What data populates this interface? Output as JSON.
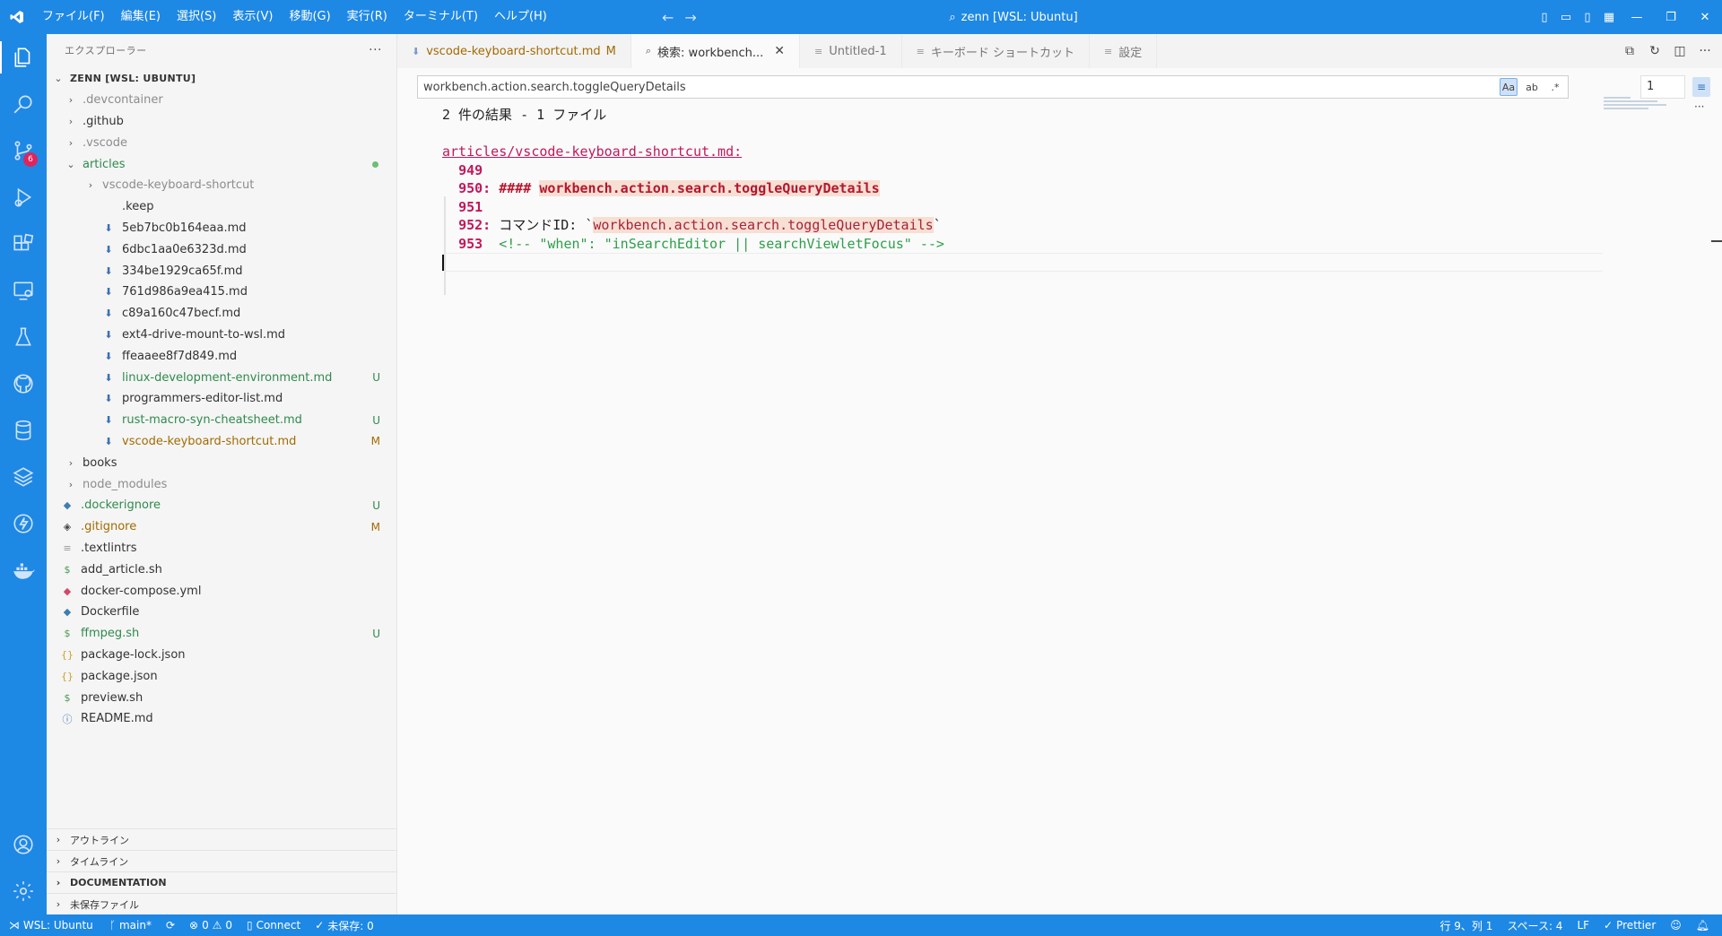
{
  "titlebar": {
    "menus": [
      "ファイル(F)",
      "編集(E)",
      "選択(S)",
      "表示(V)",
      "移動(G)",
      "実行(R)",
      "ターミナル(T)",
      "ヘルプ(H)"
    ],
    "title": "zenn [WSL: Ubuntu]"
  },
  "activity": {
    "scm_badge": "6"
  },
  "sidebar": {
    "title": "エクスプローラー",
    "root": "ZENN [WSL: UBUNTU]",
    "items": [
      {
        "label": ".devcontainer",
        "status": ""
      },
      {
        "label": ".github",
        "status": ""
      },
      {
        "label": ".vscode",
        "status": ""
      },
      {
        "label": "articles",
        "status": ""
      },
      {
        "label": "vscode-keyboard-shortcut",
        "status": ""
      },
      {
        "label": ".keep",
        "status": ""
      },
      {
        "label": "5eb7bc0b164eaa.md",
        "status": ""
      },
      {
        "label": "6dbc1aa0e6323d.md",
        "status": ""
      },
      {
        "label": "334be1929ca65f.md",
        "status": ""
      },
      {
        "label": "761d986a9ea415.md",
        "status": ""
      },
      {
        "label": "c89a160c47becf.md",
        "status": ""
      },
      {
        "label": "ext4-drive-mount-to-wsl.md",
        "status": ""
      },
      {
        "label": "ffeaaee8f7d849.md",
        "status": ""
      },
      {
        "label": "linux-development-environment.md",
        "status": "U"
      },
      {
        "label": "programmers-editor-list.md",
        "status": ""
      },
      {
        "label": "rust-macro-syn-cheatsheet.md",
        "status": "U"
      },
      {
        "label": "vscode-keyboard-shortcut.md",
        "status": "M"
      },
      {
        "label": "books",
        "status": ""
      },
      {
        "label": "node_modules",
        "status": ""
      },
      {
        "label": ".dockerignore",
        "status": "U"
      },
      {
        "label": ".gitignore",
        "status": "M"
      },
      {
        "label": ".textlintrs",
        "status": ""
      },
      {
        "label": "add_article.sh",
        "status": ""
      },
      {
        "label": "docker-compose.yml",
        "status": ""
      },
      {
        "label": "Dockerfile",
        "status": ""
      },
      {
        "label": "ffmpeg.sh",
        "status": "U"
      },
      {
        "label": "package-lock.json",
        "status": ""
      },
      {
        "label": "package.json",
        "status": ""
      },
      {
        "label": "preview.sh",
        "status": ""
      },
      {
        "label": "README.md",
        "status": ""
      }
    ],
    "sections": [
      "アウトライン",
      "タイムライン",
      "DOCUMENTATION",
      "未保存ファイル"
    ]
  },
  "tabs": [
    {
      "label": "vscode-keyboard-shortcut.md",
      "flag": "M"
    },
    {
      "label": "検索: workbench...",
      "flag": ""
    },
    {
      "label": "Untitled-1",
      "flag": ""
    },
    {
      "label": "キーボード ショートカット",
      "flag": ""
    },
    {
      "label": "設定",
      "flag": ""
    }
  ],
  "search_editor": {
    "query": "workbench.action.search.toggleQueryDetails",
    "options": [
      "Aa",
      "ab",
      ".*"
    ],
    "context_lines": "1",
    "summary": "2 件の結果 - 1 ファイル",
    "file": "articles/vscode-keyboard-shortcut.md:",
    "lines": {
      "l949": "949",
      "l950_num": "950:",
      "l950_hashes": "####",
      "l950_match": "workbench.action.search.toggleQueryDetails",
      "l951": "951",
      "l952_num": "952:",
      "l952_pre": "コマンドID: `",
      "l952_match": "workbench.action.search.toggleQueryDetails",
      "l952_post": "`",
      "l953_num": "953",
      "l953_text": "<!-- \"when\": \"inSearchEditor || searchViewletFocus\" -->"
    }
  },
  "statusbar": {
    "remote": "WSL: Ubuntu",
    "branch": "main*",
    "errors": "0",
    "warnings": "0",
    "connect": "Connect",
    "unsaved": "未保存: 0",
    "position": "行 9、列 1",
    "spaces": "スペース: 4",
    "eol": "LF",
    "formatter": "Prettier"
  },
  "colors": {
    "accent": "#1e88e5",
    "untracked": "#2f8a4c",
    "modified": "#a36a00",
    "match_bg": "#f7dfd4"
  }
}
